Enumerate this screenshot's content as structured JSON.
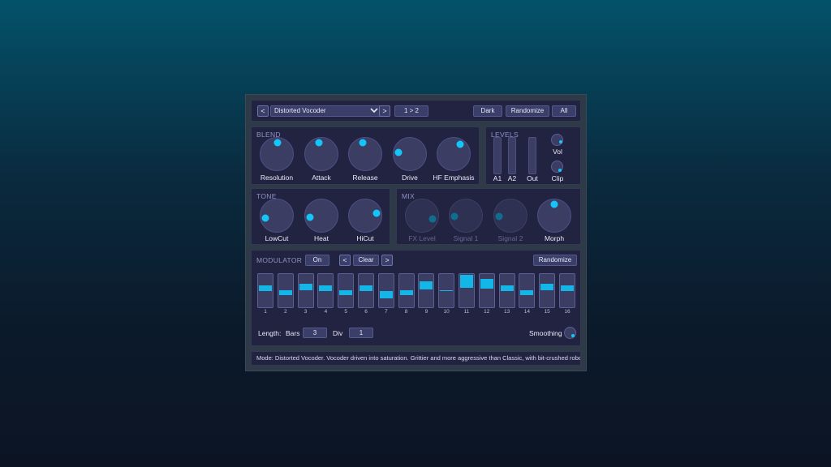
{
  "header": {
    "prev_label": "<",
    "next_label": ">",
    "preset_name": "Distorted Vocoder",
    "route_label": "1 > 2",
    "dark_label": "Dark",
    "randomize_label": "Randomize",
    "all_label": "All"
  },
  "blend": {
    "title": "BLEND",
    "knobs": [
      {
        "label": "Resolution",
        "value": 0.52
      },
      {
        "label": "Attack",
        "value": 0.45
      },
      {
        "label": "Release",
        "value": 0.45
      },
      {
        "label": "Drive",
        "value": 0.2
      },
      {
        "label": "HF Emphasis",
        "value": 0.62
      }
    ]
  },
  "levels": {
    "title": "LEVELS",
    "meters": [
      "A1",
      "A2",
      "Out"
    ],
    "vol_label": "Vol",
    "clip_label": "Clip"
  },
  "tone": {
    "title": "TONE",
    "knobs": [
      {
        "label": "LowCut",
        "value": 0.12
      },
      {
        "label": "Heat",
        "value": 0.14
      },
      {
        "label": "HiCut",
        "value": 0.78
      }
    ]
  },
  "mix": {
    "title": "MIX",
    "knobs": [
      {
        "label": "FX Level",
        "value": 0.9,
        "disabled": true
      },
      {
        "label": "Signal 1",
        "value": 0.15,
        "disabled": true
      },
      {
        "label": "Signal 2",
        "value": 0.15,
        "disabled": true
      },
      {
        "label": "Morph",
        "value": 0.5,
        "disabled": false
      }
    ]
  },
  "modulator": {
    "title": "MODULATOR",
    "on_label": "On",
    "clear_label": "Clear",
    "prev_label": "<",
    "next_label": ">",
    "randomize_label": "Randomize",
    "steps": [
      {
        "num": "1",
        "value": 0.58
      },
      {
        "num": "2",
        "value": 0.45
      },
      {
        "num": "3",
        "value": 0.6
      },
      {
        "num": "4",
        "value": 0.58
      },
      {
        "num": "5",
        "value": 0.44
      },
      {
        "num": "6",
        "value": 0.58
      },
      {
        "num": "7",
        "value": 0.38
      },
      {
        "num": "8",
        "value": 0.44
      },
      {
        "num": "9",
        "value": 0.66
      },
      {
        "num": "10",
        "value": 0.5
      },
      {
        "num": "11",
        "value": 0.8
      },
      {
        "num": "12",
        "value": 0.7
      },
      {
        "num": "13",
        "value": 0.58
      },
      {
        "num": "14",
        "value": 0.45
      },
      {
        "num": "15",
        "value": 0.6
      },
      {
        "num": "16",
        "value": 0.58
      }
    ],
    "length_label": "Length:",
    "bars_label": "Bars",
    "bars_value": "3",
    "div_label": "Div",
    "div_value": "1",
    "smoothing_label": "Smoothing"
  },
  "status": "Mode: Distorted Vocoder. Vocoder driven into saturation. Grittier and more aggressive than Classic, with bit-crushed robot vocals.",
  "colors": {
    "accent": "#13c6f7",
    "panel": "#222341",
    "control": "#3b3d63"
  }
}
